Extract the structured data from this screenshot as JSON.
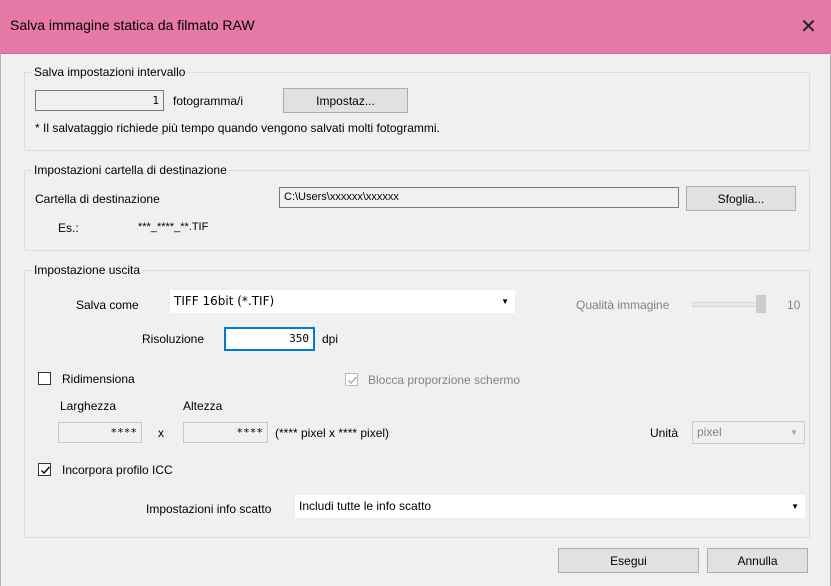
{
  "window": {
    "title": "Salva immagine statica da filmato RAW",
    "close_glyph": "✕"
  },
  "interval": {
    "group_title": "Salva impostazioni intervallo",
    "frames_value": "1",
    "frames_unit": "fotogramma/i",
    "settings_button": "Impostaz...",
    "note": "* Il salvataggio richiede più tempo quando vengono salvati molti fotogrammi."
  },
  "destination": {
    "group_title": "Impostazioni cartella di destinazione",
    "folder_label": "Cartella di destinazione",
    "folder_value": "C:\\Users\\xxxxxx\\xxxxxx",
    "browse_button": "Sfoglia...",
    "example_label": "Es.:",
    "example_value": "***_****_**.TIF"
  },
  "output": {
    "group_title": "Impostazione uscita",
    "save_as_label": "Salva come",
    "save_as_value": "TIFF 16bit (*.TIF)",
    "quality_label": "Qualità immagine",
    "quality_value": "10",
    "quality_level": 1.0,
    "resolution_label": "Risoluzione",
    "resolution_value": "350",
    "resolution_unit": "dpi",
    "resize_label": "Ridimensiona",
    "resize_checked": false,
    "lock_ratio_label": "Blocca proporzione schermo",
    "lock_ratio_checked": true,
    "width_label": "Larghezza",
    "height_label": "Altezza",
    "width_value": "****",
    "height_value": "****",
    "times": "x",
    "pixel_info": "(**** pixel x **** pixel)",
    "unit_label": "Unità",
    "unit_value": "pixel",
    "icc_label": "Incorpora profilo ICC",
    "icc_checked": true,
    "shot_info_label": "Impostazioni info scatto",
    "shot_info_value": "Includi tutte le info scatto"
  },
  "footer": {
    "execute_button": "Esegui",
    "cancel_button": "Annulla"
  },
  "icons": {
    "dropdown": "chevron-down-icon",
    "check": "checkmark-icon",
    "close": "close-icon"
  },
  "colors": {
    "titlebar": "#e779a6",
    "focus_border": "#0078d7",
    "window_bg": "#f0f0f0"
  }
}
